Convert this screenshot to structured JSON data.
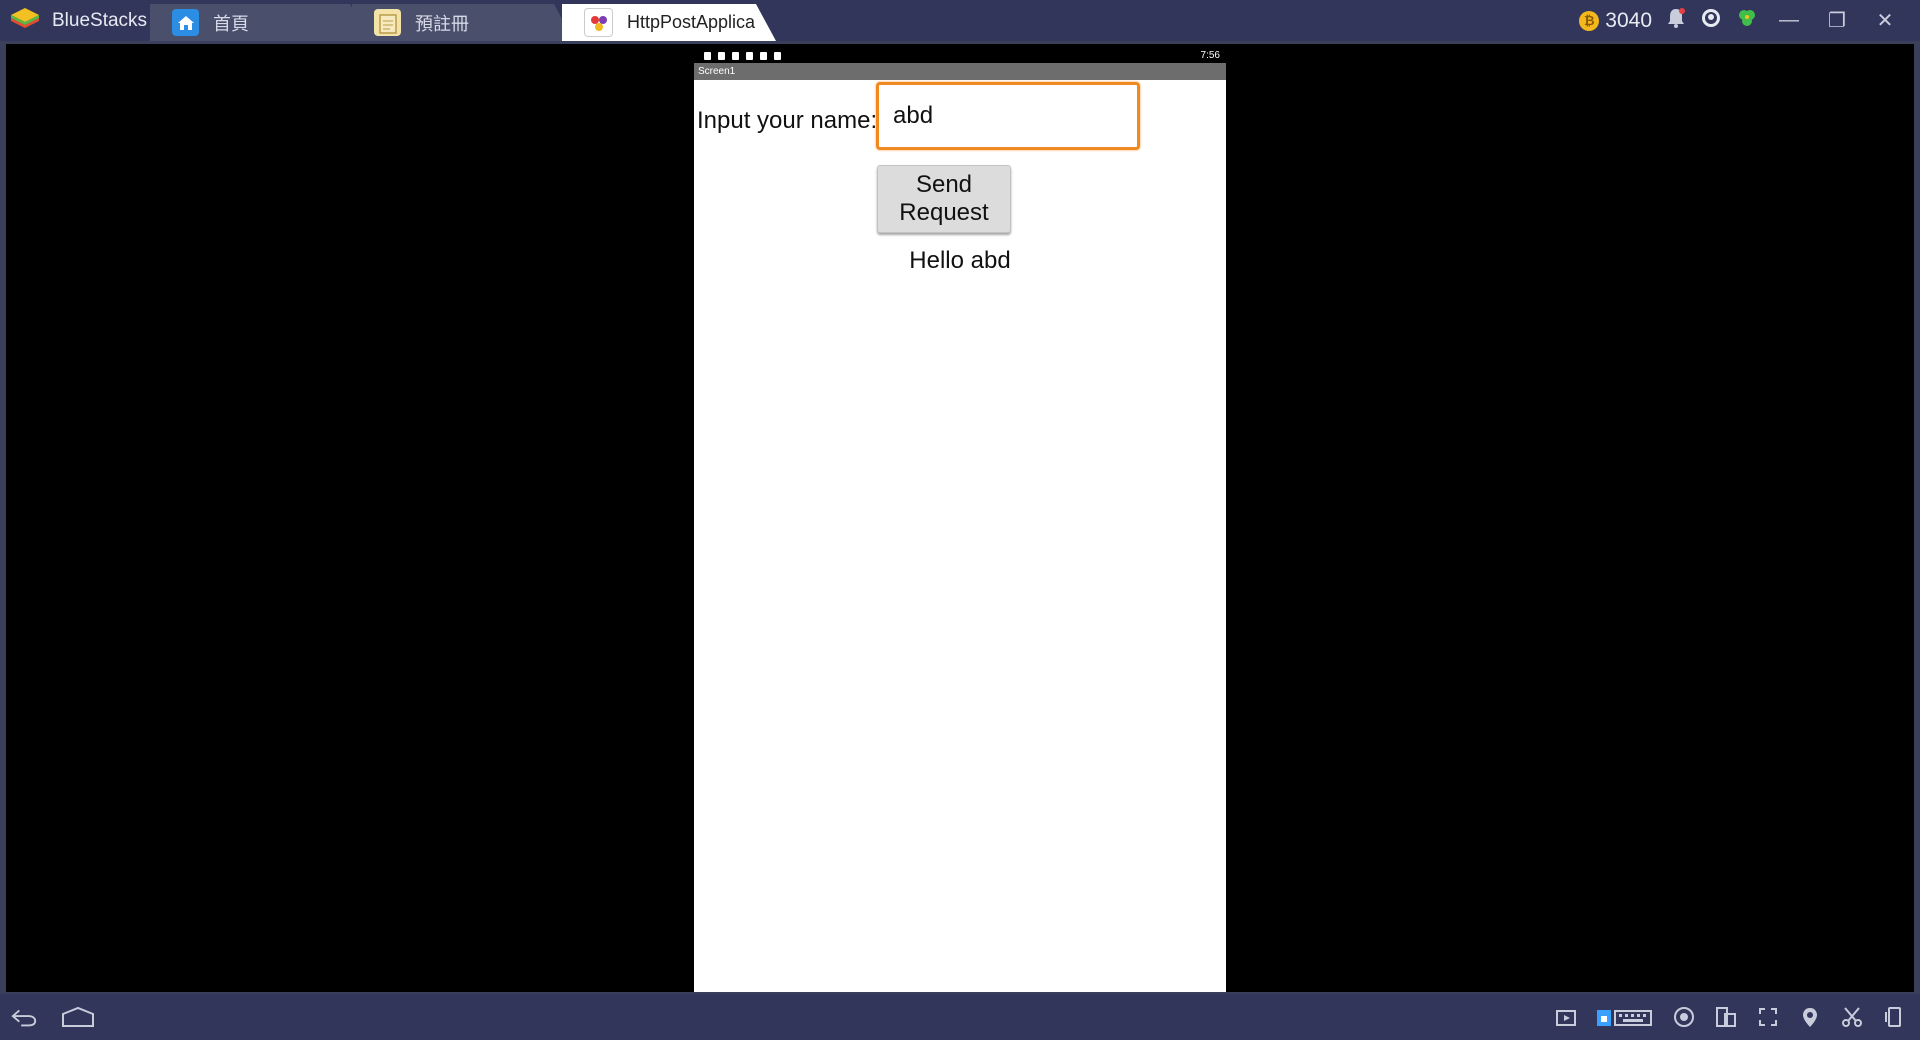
{
  "app": {
    "name": "BlueStacks"
  },
  "tabs": [
    {
      "label": "首頁"
    },
    {
      "label": "預註冊"
    },
    {
      "label": "HttpPostApplica"
    }
  ],
  "toolbar": {
    "coins": "3040"
  },
  "android": {
    "clock": "7:56",
    "screen_title": "Screen1"
  },
  "form": {
    "name_label": "Input your name:",
    "name_value": "abd",
    "send_label": "Send Request",
    "result_text": "Hello abd"
  },
  "colors": {
    "chrome": "#31365a",
    "focus_border": "#f0891f",
    "coin": "#f2b81e"
  }
}
